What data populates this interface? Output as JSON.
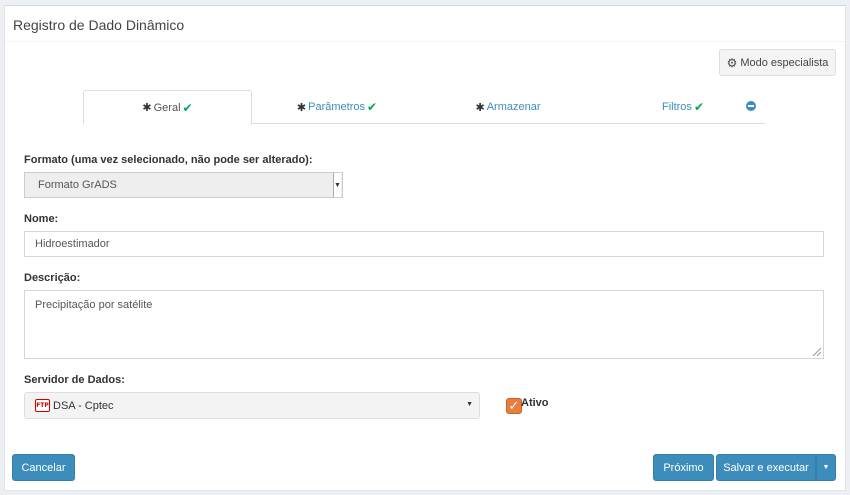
{
  "header": {
    "title": "Registro de Dado Dinâmico"
  },
  "toolbar": {
    "expert_label": "Modo especialista",
    "expert_icon": "gear-icon"
  },
  "tabs": [
    {
      "label": "Geral",
      "active": true,
      "required": true,
      "completed": true
    },
    {
      "label": "Parâmetros",
      "active": false,
      "required": true,
      "completed": true
    },
    {
      "label": "Armazenar",
      "active": false,
      "required": true,
      "completed": false
    },
    {
      "label": "Filtros",
      "active": false,
      "required": false,
      "completed": true
    }
  ],
  "form": {
    "format": {
      "label": "Formato (uma vez selecionado, não pode ser alterado):",
      "value": "Formato GrADS"
    },
    "name": {
      "label": "Nome:",
      "value": "Hidroestimador"
    },
    "description": {
      "label": "Descrição:",
      "value": "Precipitação por satélite"
    },
    "server": {
      "label": "Servidor de Dados:",
      "value": "DSA - Cptec",
      "icon_text": "FTP"
    },
    "active": {
      "label": "Ativo",
      "checked": true
    }
  },
  "footer": {
    "cancel_label": "Cancelar",
    "next_label": "Próximo",
    "save_label": "Salvar e executar"
  },
  "colors": {
    "primary": "#3c8dbc",
    "success": "#00a65a",
    "checkbox": "#e67e3c"
  }
}
